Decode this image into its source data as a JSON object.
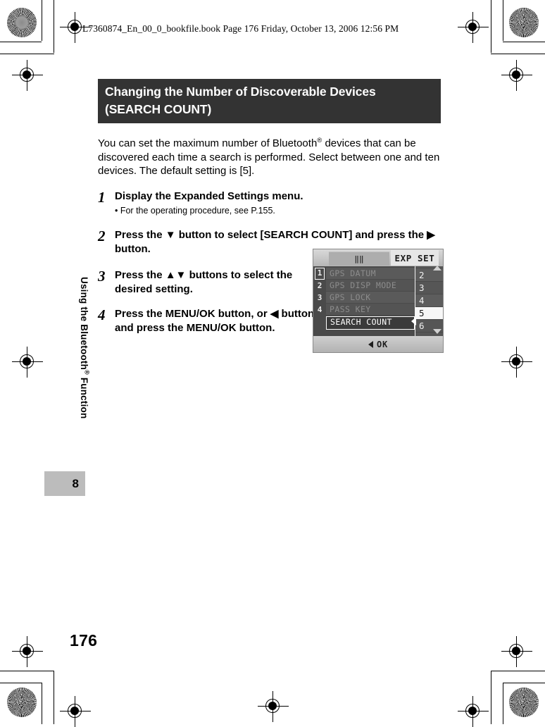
{
  "running_header": "L7360874_En_00_0_bookfile.book  Page 176  Friday, October 13, 2006  12:56 PM",
  "sidebar": {
    "vertical_tab_label": "Using the Bluetooth",
    "vertical_tab_suffix": " Function",
    "registered_mark": "®",
    "chapter_number": "8",
    "page_number": "176"
  },
  "section": {
    "title_line1": "Changing the Number of Discoverable Devices",
    "title_line2": "(SEARCH COUNT)",
    "intro_part1": "You can set the maximum number of Bluetooth",
    "intro_sup": "®",
    "intro_part2": " devices that can be discovered each time a search is performed. Select between one and ten devices. The default setting is [5]."
  },
  "steps": [
    {
      "number": "1",
      "heading": "Display the Expanded Settings menu.",
      "bullet": "•  For the operating procedure, see P.155."
    },
    {
      "number": "2",
      "heading": "Press the ▼ button to select [SEARCH COUNT] and press the ▶ button.",
      "bullet": ""
    },
    {
      "number": "3",
      "heading": "Press the ▲▼ buttons to select the desired setting.",
      "bullet": ""
    },
    {
      "number": "4",
      "heading": "Press the MENU/OK button, or ◀ button and press the MENU/OK button.",
      "bullet": ""
    }
  ],
  "lcd": {
    "tab_left_label": "‖‖",
    "tab_right_label": "EXP SET",
    "row_numbers": [
      "1",
      "2",
      "3",
      "4"
    ],
    "menu_items": [
      "GPS DATUM",
      "GPS DISP MODE",
      "GPS LOCK",
      "PASS KEY"
    ],
    "selected_menu_item": "SEARCH COUNT",
    "values": [
      "2",
      "3",
      "4",
      "5",
      "6"
    ],
    "selected_value": "5",
    "footer_label": "OK",
    "scroll_up_icon": "triangle-up-icon",
    "scroll_down_icon": "triangle-down-icon",
    "accent_color": "#f7f7f7",
    "panel_color": "#4a4a4a"
  },
  "colors": {
    "section_title_bg": "#333333",
    "section_title_fg": "#ffffff",
    "chapter_box_bg": "#bcbcbc"
  }
}
